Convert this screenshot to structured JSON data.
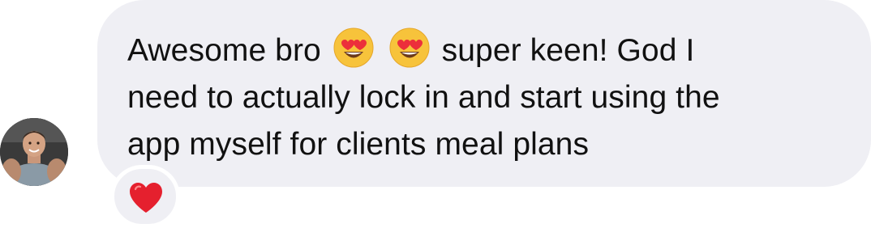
{
  "message": {
    "line_1_before": "Awesome bro",
    "line_1_after": "super keen! God I",
    "line_2": "need to actually lock in and start using the",
    "line_3": "app myself for clients meal plans",
    "emojis": [
      "heart-eyes-emoji",
      "heart-eyes-emoji"
    ],
    "bubble_color": "#efeff4",
    "text_color": "#111111"
  },
  "reaction": {
    "icon": "red-heart-icon",
    "color": "#e5202e"
  },
  "avatar": {
    "icon": "user-avatar"
  }
}
